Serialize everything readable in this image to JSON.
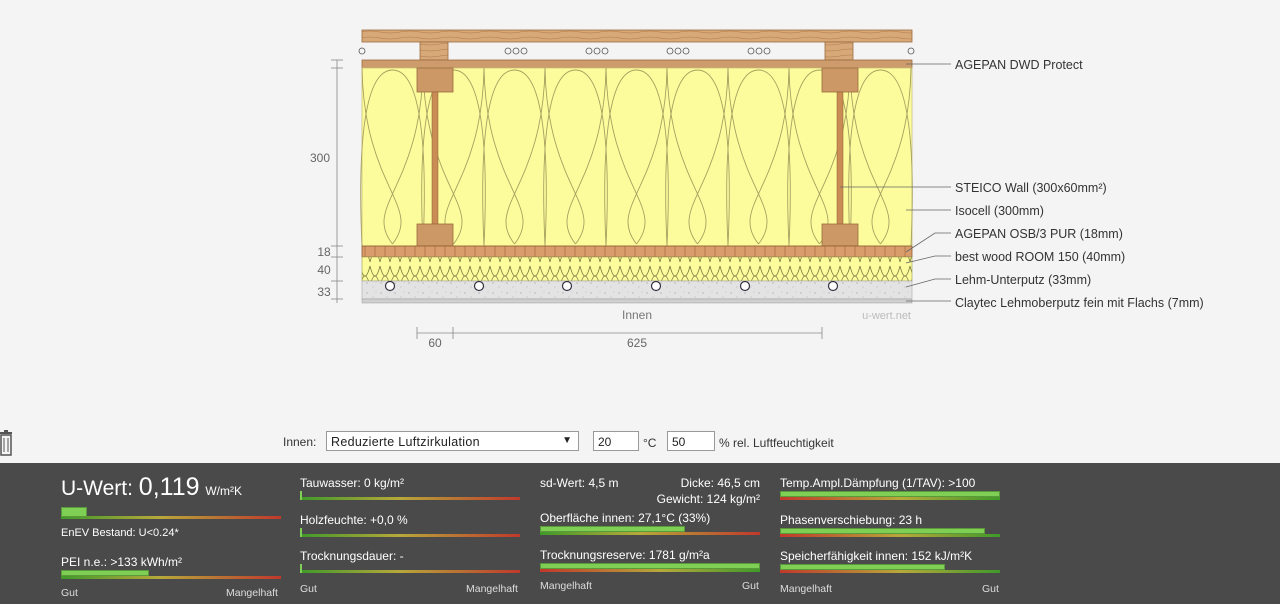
{
  "diagram": {
    "layer_labels": [
      "AGEPAN DWD Protect",
      "STEICO  Wall (300x60mm²)",
      "Isocell (300mm)",
      "AGEPAN OSB/3 PUR (18mm)",
      "best wood ROOM 150 (40mm)",
      "Lehm-Unterputz (33mm)",
      "Claytec Lehmoberputz fein mit Flachs (7mm)"
    ],
    "dimensions_left": [
      "300",
      "18",
      "40",
      "33"
    ],
    "dimensions_bottom": [
      "60",
      "625"
    ],
    "side_label": "Innen",
    "watermark": "u-wert.net",
    "colors": {
      "insulation": "#fdfc9c",
      "wood": "#cc9966",
      "plaster": "#e3e3e3"
    }
  },
  "controls": {
    "inside_label": "Innen:",
    "mode_value": "Reduzierte Luftzirkulation",
    "temperature": "20",
    "temp_unit": "°C",
    "humidity": "50",
    "humidity_unit": "% rel. Luftfeuchtigkeit",
    "trash_icon": "trash-icon"
  },
  "results": {
    "uwert_label": "U-Wert:",
    "uwert_value": "0,119",
    "uwert_unit": "W/m²K",
    "uwert_level": 0.12,
    "enev": "EnEV Bestand: U<0.24*",
    "pei": "PEI n.e.: >133 kWh/m²",
    "pei_level": 0.4,
    "scale_good": "Gut",
    "scale_bad": "Mangelhaft",
    "tauwasser": "Tauwasser: 0 kg/m²",
    "holzfeuchte": "Holzfeuchte: +0,0 %",
    "trocknungsdauer": "Trocknungsdauer: -",
    "sd_wert": "sd-Wert: 4,5 m",
    "dicke": "Dicke: 46,5 cm",
    "gewicht": "Gewicht: 124 kg/m²",
    "oberflaeche": "Oberfläche innen: 27,1°C (33%)",
    "oberflaeche_level": 0.66,
    "trocknungsreserve": "Trocknungsreserve: 1781 g/m²a",
    "trocknungsreserve_level": 1.0,
    "temp_ampl": "Temp.Ampl.Dämpfung (1/TAV): >100",
    "temp_ampl_level": 1.0,
    "phasen": "Phasenverschiebung: 23 h",
    "phasen_level": 0.93,
    "speicher": "Speicherfähigkeit innen: 152 kJ/m²K",
    "speicher_level": 0.75
  }
}
